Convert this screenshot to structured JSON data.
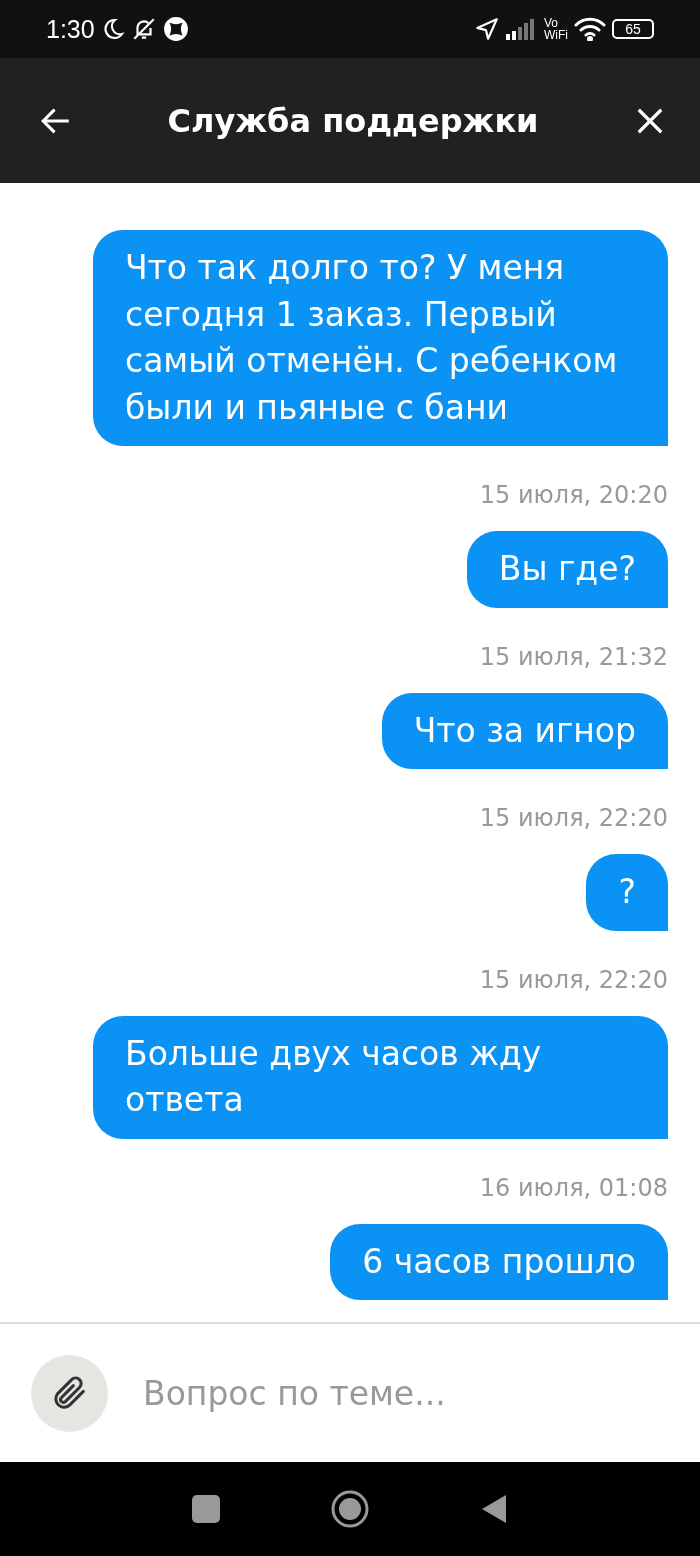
{
  "status_bar": {
    "time": "1:30",
    "vowifi_top": "Vo",
    "vowifi_bottom": "WiFi",
    "battery": "65"
  },
  "header": {
    "title": "Служба поддержки"
  },
  "messages": [
    {
      "kind": "message",
      "text": "Что так долго то? У меня сегодня 1 заказ. Первый самый отменён. С ребенком были и пьяные с бани"
    },
    {
      "kind": "timestamp",
      "text": "15 июля, 20:20"
    },
    {
      "kind": "message",
      "text": "Вы где?"
    },
    {
      "kind": "timestamp",
      "text": "15 июля, 21:32"
    },
    {
      "kind": "message",
      "text": "Что за игнор"
    },
    {
      "kind": "timestamp",
      "text": "15 июля, 22:20"
    },
    {
      "kind": "message",
      "text": "?"
    },
    {
      "kind": "timestamp",
      "text": "15 июля, 22:20"
    },
    {
      "kind": "message",
      "text": "Больше двух часов жду ответа"
    },
    {
      "kind": "timestamp",
      "text": "16 июля, 01:08"
    },
    {
      "kind": "message",
      "text": "6 часов прошло"
    }
  ],
  "composer": {
    "placeholder": "Вопрос по теме..."
  }
}
